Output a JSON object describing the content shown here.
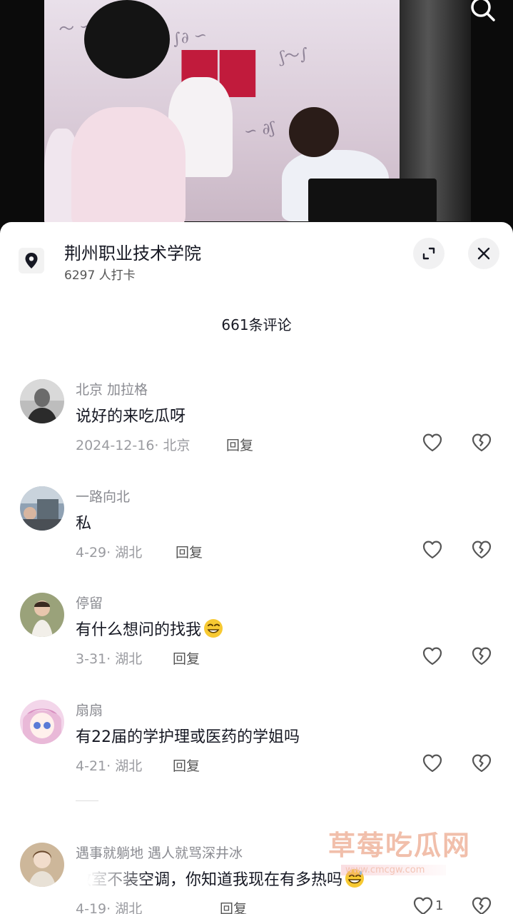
{
  "location": {
    "name": "荆州职业技术学院",
    "checkins": "6297 人打卡"
  },
  "comments_header": {
    "count_label": "661条评论"
  },
  "comments": [
    {
      "user": "北京 加拉格",
      "text": "说好的来吃瓜呀",
      "date_location": "2024-12-16· 北京",
      "reply_label": "回复",
      "avatar_icon": "avatar-portrait"
    },
    {
      "user": "一路向北",
      "text": "私",
      "date_location": "4-29· 湖北",
      "reply_label": "回复",
      "avatar_icon": "avatar-photo"
    },
    {
      "user": "停留",
      "text": "有什么想问的找我",
      "date_location": "3-31· 湖北",
      "reply_label": "回复",
      "emoji": "grinning-face-emoji",
      "avatar_icon": "avatar-child"
    },
    {
      "user": "扇扇",
      "text": "有22届的学护理或医药的学姐吗",
      "date_location": "4-21· 湖北",
      "reply_label": "回复",
      "avatar_icon": "avatar-anime"
    },
    {
      "user": "遇事就躺地  遇人就骂深井冰",
      "text": "教室不装空调，你知道我现在有多热吗",
      "date_location": "4-19· 湖北",
      "reply_label": "回复",
      "like_count": "1",
      "emoji": "sweat-smile-emoji",
      "avatar_icon": "avatar-person"
    }
  ],
  "watermark": {
    "title": "草莓吃瓜网",
    "url": "www.cmcgw.com"
  },
  "icons": {
    "search": "search-icon",
    "location": "location-pin-icon",
    "expand": "expand-icon",
    "close": "close-icon",
    "like": "heart-icon",
    "dislike": "broken-heart-icon"
  },
  "colors": {
    "sheet_bg": "#ffffff",
    "primary_text": "#161823",
    "secondary_text": "#8a8b91",
    "watermark": "#f0b9a3",
    "banner_red": "#c11b3c"
  }
}
